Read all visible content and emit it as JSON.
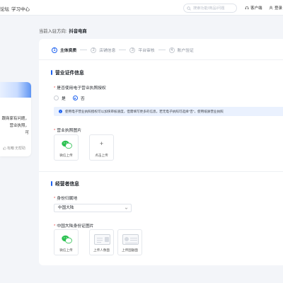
{
  "topnav": {
    "links": [
      "论坛",
      "学习中心"
    ],
    "search_placeholder": "搜索功能/商品/问题",
    "customer_service": "客户端",
    "account": "登录"
  },
  "left_card": {
    "line1": "跟商家有问题，",
    "line2": "营业执照，",
    "line3": "可",
    "like": "有用",
    "unlike": "无帮助"
  },
  "breadcrumb": {
    "prefix": "当前入驻方向:",
    "value": "抖音电商"
  },
  "steps": [
    {
      "num": "1",
      "label": "主体资质"
    },
    {
      "num": "2",
      "label": "店铺信息"
    },
    {
      "num": "3",
      "label": "平台审核"
    },
    {
      "num": "4",
      "label": "账户验证"
    }
  ],
  "license_section": {
    "title": "营业证件信息",
    "question": "是否使用电子营业执照授权",
    "options": [
      "是",
      "否"
    ],
    "selected": "否",
    "notice": "使用电子营业执照授权可以加快审核速度，但需填写更多的信息。若无电子执照可选择\"否\"，使用纸质营业执照",
    "photo_label": "营业执照图片",
    "upload_wechat": "微信上传",
    "upload_click": "点击上传"
  },
  "operator_section": {
    "title": "经营者信息",
    "region_label": "身份归属地",
    "region_value": "中国大陆",
    "id_label": "中国大陆身份证图片",
    "upload_wechat": "微信上传",
    "upload_front": "上传人像面",
    "upload_back": "上传国徽面"
  },
  "colors": {
    "accent": "#1e62f0",
    "required": "#f04d4d",
    "wechat": "#2bc150"
  }
}
